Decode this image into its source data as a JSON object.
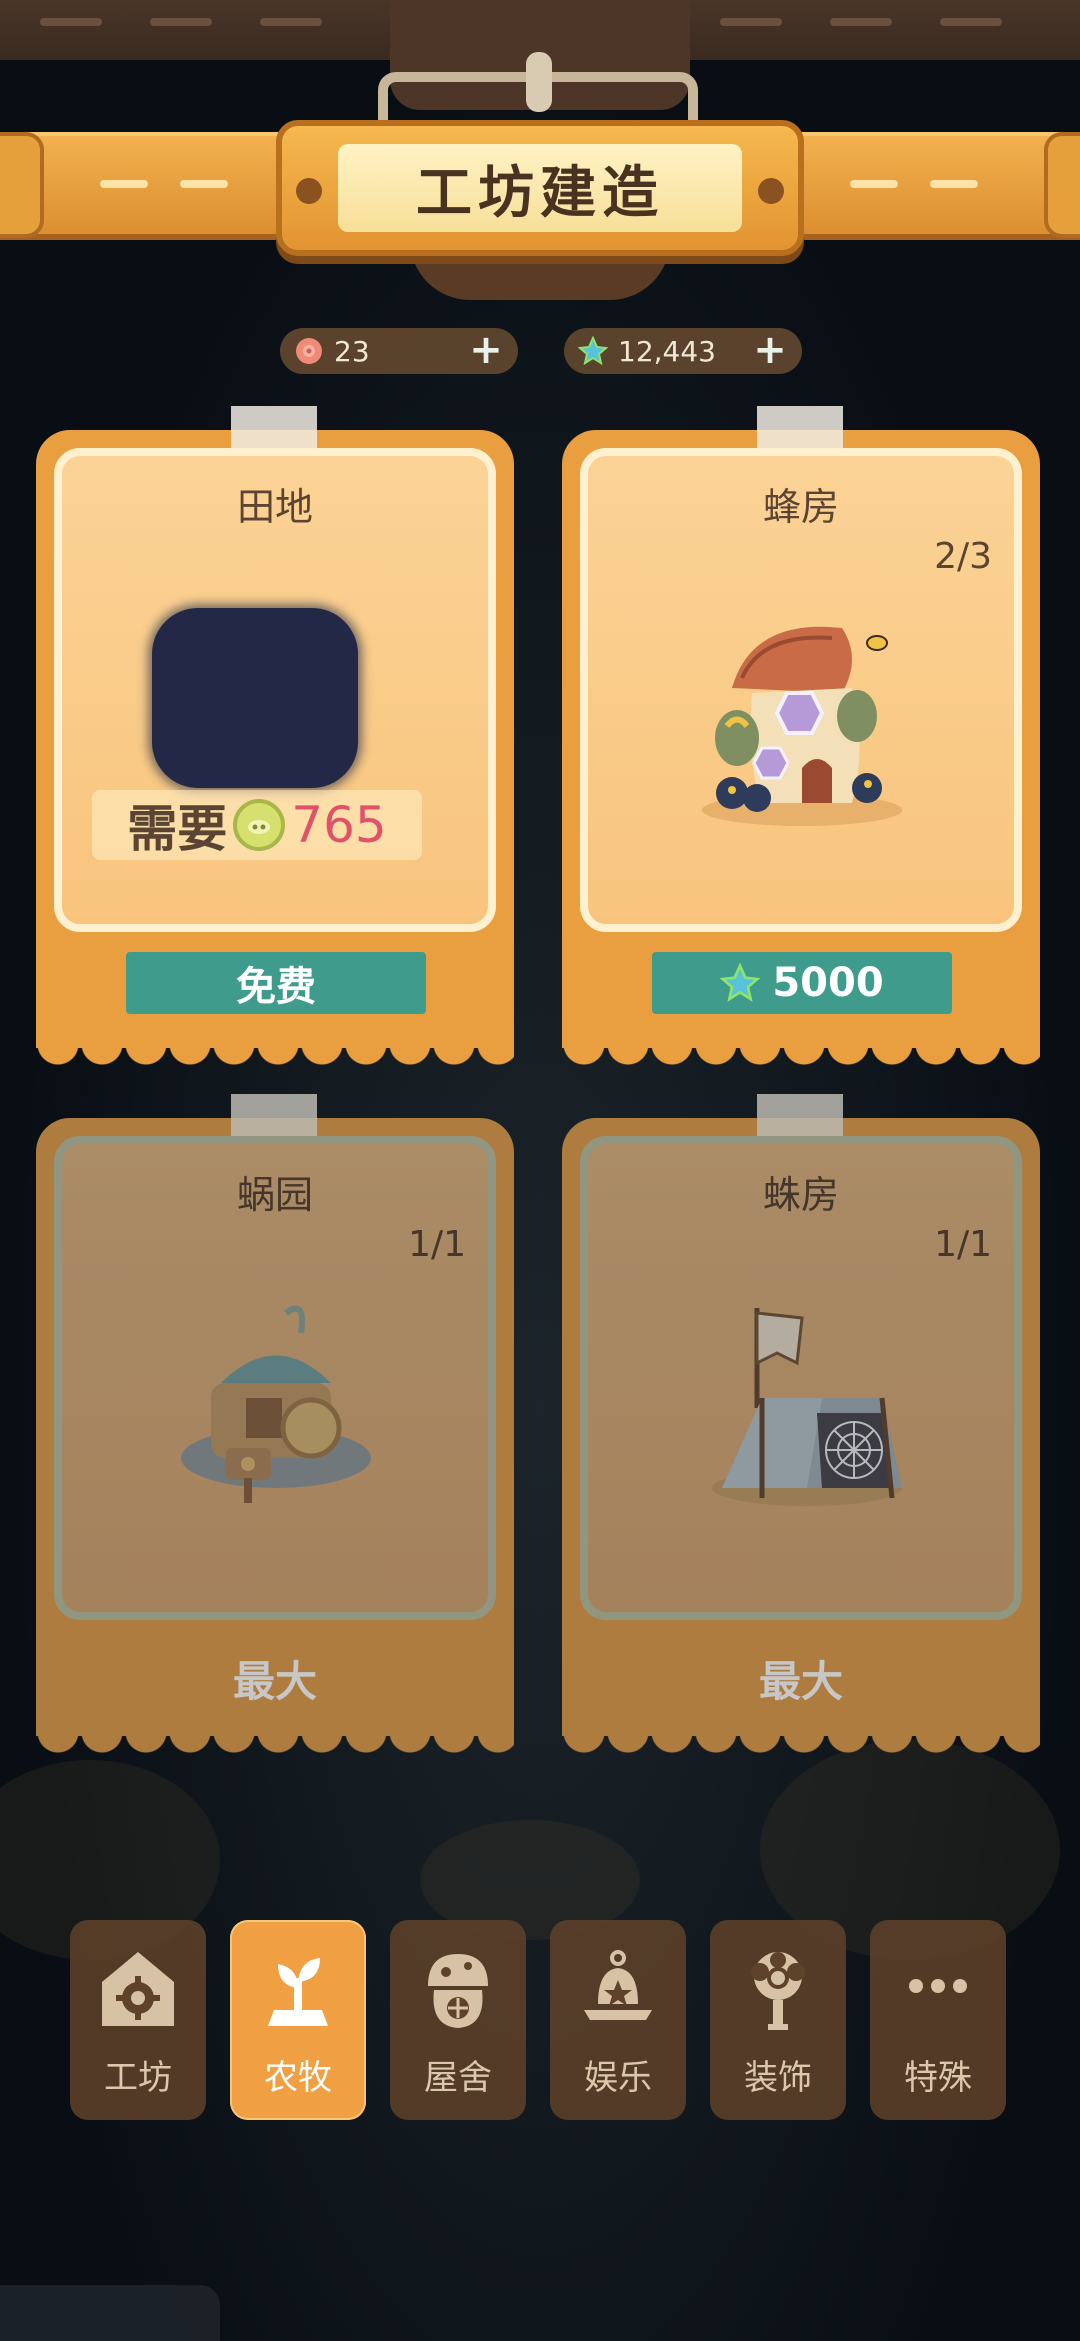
{
  "header": {
    "title": "工坊建造"
  },
  "currencies": [
    {
      "icon": "flower-token-icon",
      "value": "23"
    },
    {
      "icon": "star-gem-icon",
      "value": "12,443"
    }
  ],
  "cards": [
    {
      "name": "田地",
      "count": "",
      "need_label": "需要",
      "need_value": "765",
      "button_label": "免费",
      "state": "buy"
    },
    {
      "name": "蜂房",
      "count": "2/3",
      "button_label": "5000",
      "state": "buy"
    },
    {
      "name": "蜗园",
      "count": "1/1",
      "max_label": "最大",
      "state": "max"
    },
    {
      "name": "蛛房",
      "count": "1/1",
      "max_label": "最大",
      "state": "max"
    }
  ],
  "tabs": [
    {
      "label": "工坊",
      "icon": "gear-house-icon",
      "active": false
    },
    {
      "label": "农牧",
      "icon": "sprout-icon",
      "active": true
    },
    {
      "label": "屋舍",
      "icon": "mushroom-house-icon",
      "active": false
    },
    {
      "label": "娱乐",
      "icon": "bell-icon",
      "active": false
    },
    {
      "label": "装饰",
      "icon": "flower-lamp-icon",
      "active": false
    },
    {
      "label": "特殊",
      "icon": "more-dots-icon",
      "active": false
    }
  ],
  "colors": {
    "accent_orange": "#e99e40",
    "button_teal": "#3f9c8d",
    "need_value_pink": "#e0526a",
    "active_tab": "#f0a042"
  }
}
